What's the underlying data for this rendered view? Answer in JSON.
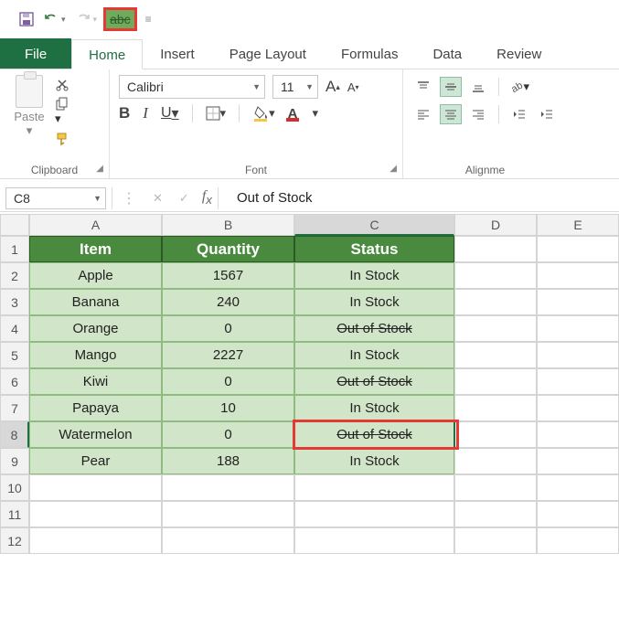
{
  "qat": {
    "strike_glyph": "abc"
  },
  "tabs": {
    "file": "File",
    "home": "Home",
    "insert": "Insert",
    "pagelayout": "Page Layout",
    "formulas": "Formulas",
    "data": "Data",
    "review": "Review"
  },
  "ribbon": {
    "clipboard": {
      "paste": "Paste",
      "label": "Clipboard"
    },
    "font": {
      "name": "Calibri",
      "size": "11",
      "bold": "B",
      "italic": "I",
      "underline": "U",
      "label": "Font"
    },
    "align": {
      "label": "Alignme"
    }
  },
  "namebox": {
    "ref": "C8"
  },
  "formula": {
    "value": "Out of Stock"
  },
  "colHeaders": [
    "A",
    "B",
    "C",
    "D",
    "E"
  ],
  "rowHeaders": [
    "1",
    "2",
    "3",
    "4",
    "5",
    "6",
    "7",
    "8",
    "9",
    "10",
    "11",
    "12"
  ],
  "table": {
    "headers": {
      "item": "Item",
      "qty": "Quantity",
      "status": "Status"
    },
    "rows": [
      {
        "item": "Apple",
        "qty": "1567",
        "status": "In Stock",
        "strike": false
      },
      {
        "item": "Banana",
        "qty": "240",
        "status": "In Stock",
        "strike": false
      },
      {
        "item": "Orange",
        "qty": "0",
        "status": "Out of Stock",
        "strike": true
      },
      {
        "item": "Mango",
        "qty": "2227",
        "status": "In Stock",
        "strike": false
      },
      {
        "item": "Kiwi",
        "qty": "0",
        "status": "Out of Stock",
        "strike": true
      },
      {
        "item": "Papaya",
        "qty": "10",
        "status": "In Stock",
        "strike": false
      },
      {
        "item": "Watermelon",
        "qty": "0",
        "status": "Out of Stock",
        "strike": true
      },
      {
        "item": "Pear",
        "qty": "188",
        "status": "In Stock",
        "strike": false
      }
    ]
  },
  "chart_data": {
    "type": "table",
    "columns": [
      "Item",
      "Quantity",
      "Status"
    ],
    "rows": [
      [
        "Apple",
        1567,
        "In Stock"
      ],
      [
        "Banana",
        240,
        "In Stock"
      ],
      [
        "Orange",
        0,
        "Out of Stock"
      ],
      [
        "Mango",
        2227,
        "In Stock"
      ],
      [
        "Kiwi",
        0,
        "Out of Stock"
      ],
      [
        "Papaya",
        10,
        "In Stock"
      ],
      [
        "Watermelon",
        0,
        "Out of Stock"
      ],
      [
        "Pear",
        188,
        "In Stock"
      ]
    ]
  }
}
